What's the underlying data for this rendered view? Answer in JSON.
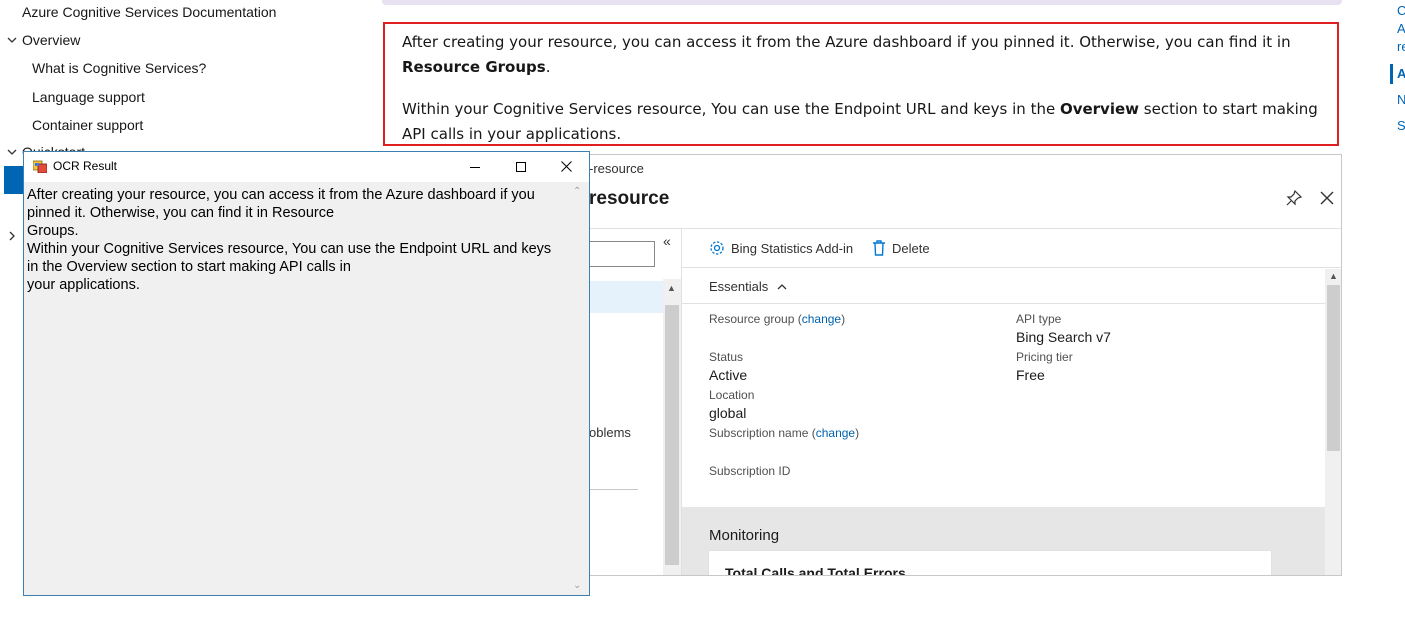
{
  "docs_nav": {
    "title": "Azure Cognitive Services Documentation",
    "overview": "Overview",
    "items": [
      "What is Cognitive Services?",
      "Language support",
      "Container support"
    ],
    "partial": "Quickstart"
  },
  "callout": {
    "p1_text": "After creating your resource, you can access it from the Azure dashboard if you pinned it. Otherwise, you can find it in ",
    "p1_bold": "Resource Groups",
    "p1_end": ".",
    "p2_start": "Within your Cognitive Services resource, You can use the Endpoint URL and keys in the ",
    "p2_bold": "Overview",
    "p2_end": " section to start making API calls in your applications."
  },
  "portal": {
    "breadcrumb": "-resource",
    "blade_title": "resource",
    "collapse_glyph": "«",
    "left_partial": "oblems",
    "toolbar": {
      "addin": "Bing Statistics Add-in",
      "delete": "Delete"
    },
    "essentials_label": "Essentials",
    "change_link": "change",
    "fields": {
      "resource_group_label": "Resource group",
      "status_label": "Status",
      "status_value": "Active",
      "location_label": "Location",
      "location_value": "global",
      "subscription_name_label": "Subscription name",
      "subscription_id_label": "Subscription ID",
      "api_type_label": "API type",
      "api_type_value": "Bing Search v7",
      "pricing_tier_label": "Pricing tier",
      "pricing_tier_value": "Free"
    },
    "monitoring": "Monitoring",
    "card_title": "Total Calls and Total Errors"
  },
  "ocr_window": {
    "title": "OCR Result",
    "text": "After creating your resource, you can access it from the Azure dashboard if you\npinned it. Otherwise, you can find it in Resource\nGroups.\nWithin your Cognitive Services resource, You can use the Endpoint URL and keys\nin the Overview section to start making API calls in\nyour applications."
  },
  "right_rail": [
    "C",
    "A",
    "re",
    "A",
    "N",
    "S"
  ],
  "colors": {
    "accent": "#0065b3",
    "callout_border": "#e02020",
    "ocr_border": "#3c7fb1"
  }
}
